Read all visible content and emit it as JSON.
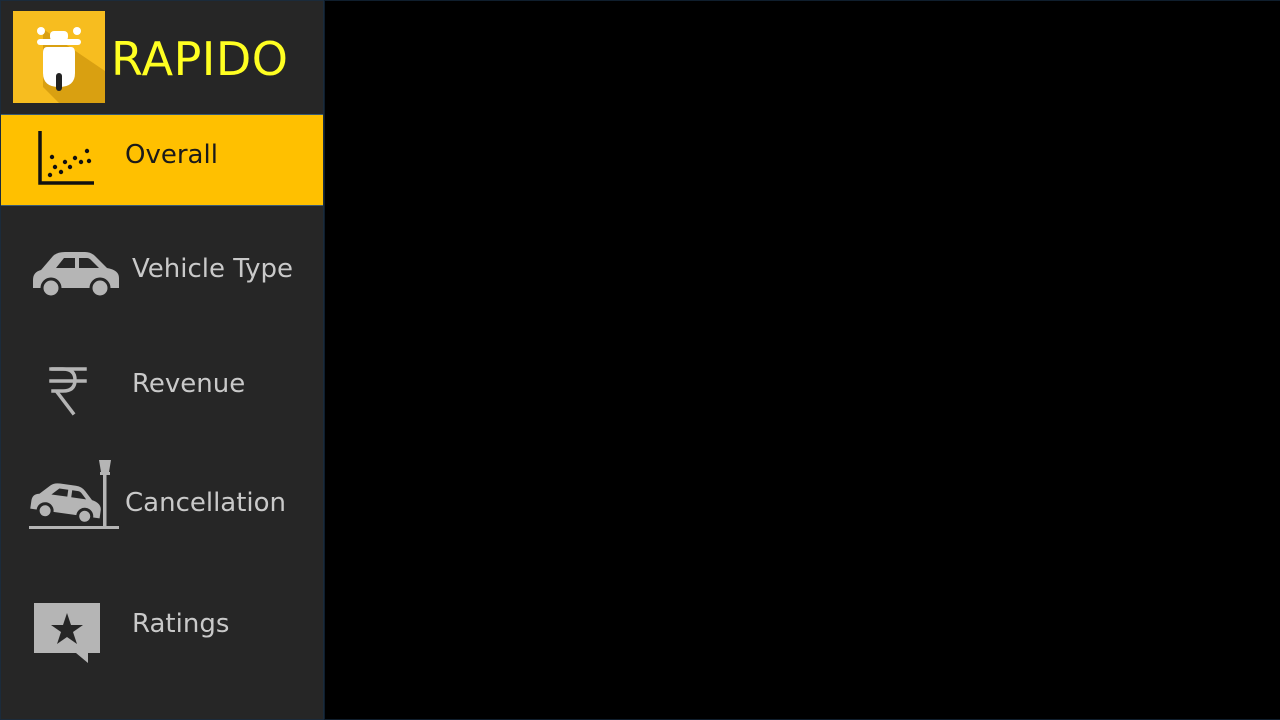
{
  "brand": {
    "name": "RAPIDO",
    "logo_icon": "scooter-icon",
    "logo_color": "#f7bd1f",
    "name_color": "#ffff22"
  },
  "colors": {
    "sidebar_bg": "#262626",
    "active_bg": "#ffc000",
    "inactive_text": "#c9c9c9",
    "main_bg": "#000000"
  },
  "sidebar": {
    "items": [
      {
        "label": "Overall",
        "icon": "scatter-chart-icon",
        "active": true
      },
      {
        "label": "Vehicle Type",
        "icon": "car-icon",
        "active": false
      },
      {
        "label": "Revenue",
        "icon": "rupee-icon",
        "active": false
      },
      {
        "label": "Cancellation",
        "icon": "car-crash-icon",
        "active": false
      },
      {
        "label": "Ratings",
        "icon": "star-comment-icon",
        "active": false
      }
    ]
  }
}
